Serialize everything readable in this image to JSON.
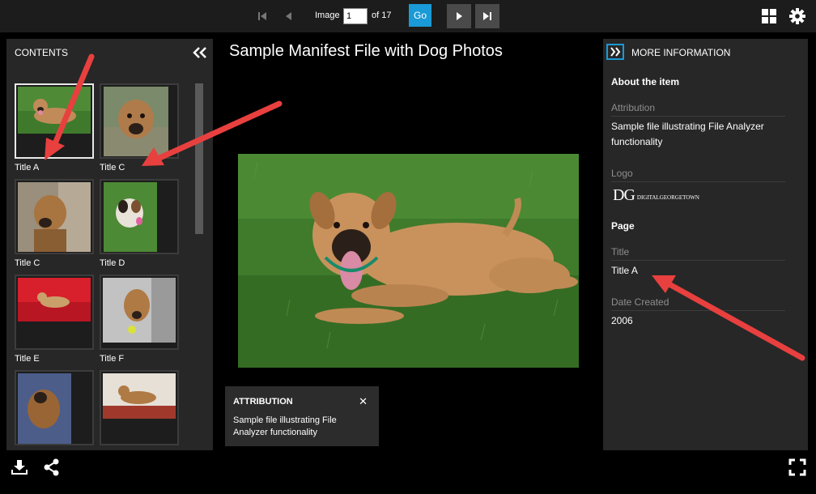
{
  "toolbar": {
    "image_label": "Image",
    "page_value": "1",
    "of_label": "of 17",
    "go_label": "Go",
    "icons": [
      "first-page-icon",
      "previous-page-icon",
      "next-page-icon",
      "last-page-icon",
      "gallery-grid-icon",
      "settings-gear-icon"
    ]
  },
  "contents": {
    "title": "CONTENTS",
    "thumbnails": [
      {
        "caption": "Title A",
        "selected": true
      },
      {
        "caption": "Title C",
        "selected": false
      },
      {
        "caption": "Title C",
        "selected": false
      },
      {
        "caption": "Title D",
        "selected": false
      },
      {
        "caption": "Title E",
        "selected": false
      },
      {
        "caption": "Title F",
        "selected": false
      },
      {
        "caption": "",
        "selected": false
      },
      {
        "caption": "",
        "selected": false
      }
    ]
  },
  "main": {
    "title": "Sample Manifest File with Dog Photos"
  },
  "attribution_popup": {
    "title": "ATTRIBUTION",
    "close_symbol": "✕",
    "text": "Sample file illustrating File Analyzer functionality"
  },
  "more_info": {
    "title": "MORE INFORMATION",
    "about_heading": "About the item",
    "attribution_label": "Attribution",
    "attribution_value": "Sample file illustrating File Analyzer functionality",
    "logo_label": "Logo",
    "logo_mark": "DG",
    "logo_text": "DIGITALGEORGETOWN",
    "page_heading": "Page",
    "title_label": "Title",
    "title_value": "Title A",
    "date_label": "Date Created",
    "date_value": "2006"
  },
  "bottom_bar": {
    "icons": [
      "download-icon",
      "share-icon",
      "fullscreen-icon"
    ]
  },
  "colors": {
    "accent": "#1a9ad6",
    "panel": "#272727",
    "annotation_arrow": "#e8403f"
  }
}
